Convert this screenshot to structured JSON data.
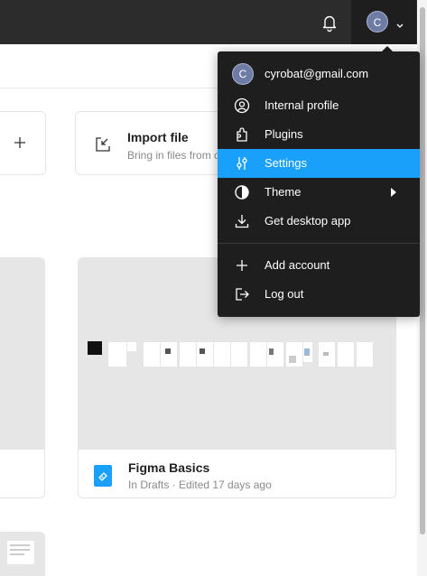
{
  "topbar": {
    "avatar_initial": "C",
    "icons": {
      "notifications": "bell-icon",
      "expand": "chevron-down-icon"
    }
  },
  "actions": {
    "new_file_icon": "plus-icon",
    "import": {
      "title": "Import file",
      "subtitle": "Bring in files from o"
    }
  },
  "files": [
    {
      "title": "Figma Basics",
      "meta": "In Drafts · Edited 17 days ago"
    }
  ],
  "account_menu": {
    "email": "cyrobat@gmail.com",
    "avatar_initial": "C",
    "items": [
      {
        "label": "Internal profile",
        "icon": "profile-icon"
      },
      {
        "label": "Plugins",
        "icon": "plugin-icon"
      },
      {
        "label": "Settings",
        "icon": "settings-sliders-icon",
        "active": true
      },
      {
        "label": "Theme",
        "icon": "theme-contrast-icon",
        "submenu": true
      },
      {
        "label": "Get desktop app",
        "icon": "download-icon"
      }
    ],
    "footer_items": [
      {
        "label": "Add account",
        "icon": "plus-icon"
      },
      {
        "label": "Log out",
        "icon": "logout-icon"
      }
    ]
  },
  "colors": {
    "accent": "#18a0fb",
    "topbar": "#2c2c2c",
    "menu_bg": "#1e1e1e"
  }
}
